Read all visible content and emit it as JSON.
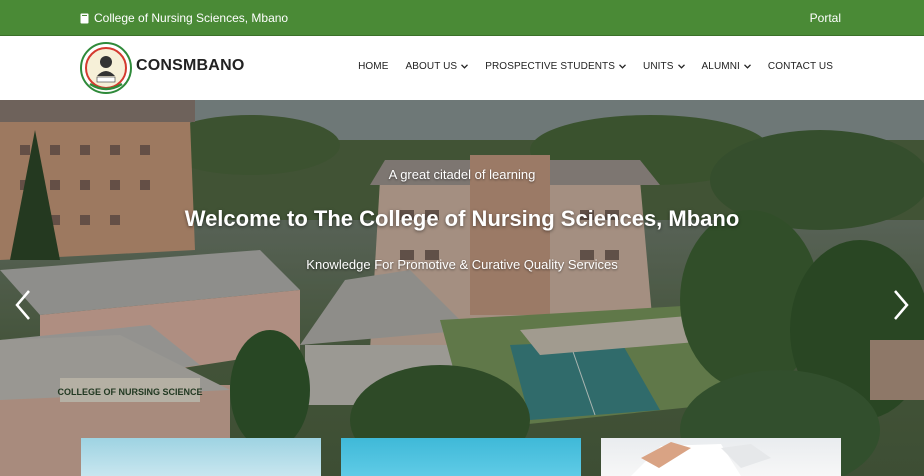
{
  "topbar": {
    "college_name": "College of Nursing Sciences, Mbano",
    "portal_label": "Portal"
  },
  "header": {
    "brand": "CONSMBANO",
    "nav": [
      {
        "label": "HOME",
        "dropdown": false
      },
      {
        "label": "ABOUT US",
        "dropdown": true
      },
      {
        "label": "PROSPECTIVE STUDENTS",
        "dropdown": true
      },
      {
        "label": "UNITS",
        "dropdown": true
      },
      {
        "label": "ALUMNI",
        "dropdown": true
      },
      {
        "label": "CONTACT US",
        "dropdown": false
      }
    ]
  },
  "hero": {
    "tagline": "A great citadel of learning",
    "title": "Welcome to The College of Nursing Sciences, Mbano",
    "subtitle": "Knowledge For Promotive & Curative Quality Services",
    "sign_text": "COLLEGE OF NURSING SCIENCE"
  },
  "colors": {
    "topbar_green": "#4a8a36",
    "text_dark": "#222222",
    "white": "#ffffff"
  },
  "icons": [
    "book-icon",
    "chevron-down-icon",
    "arrow-left-icon",
    "arrow-right-icon"
  ]
}
